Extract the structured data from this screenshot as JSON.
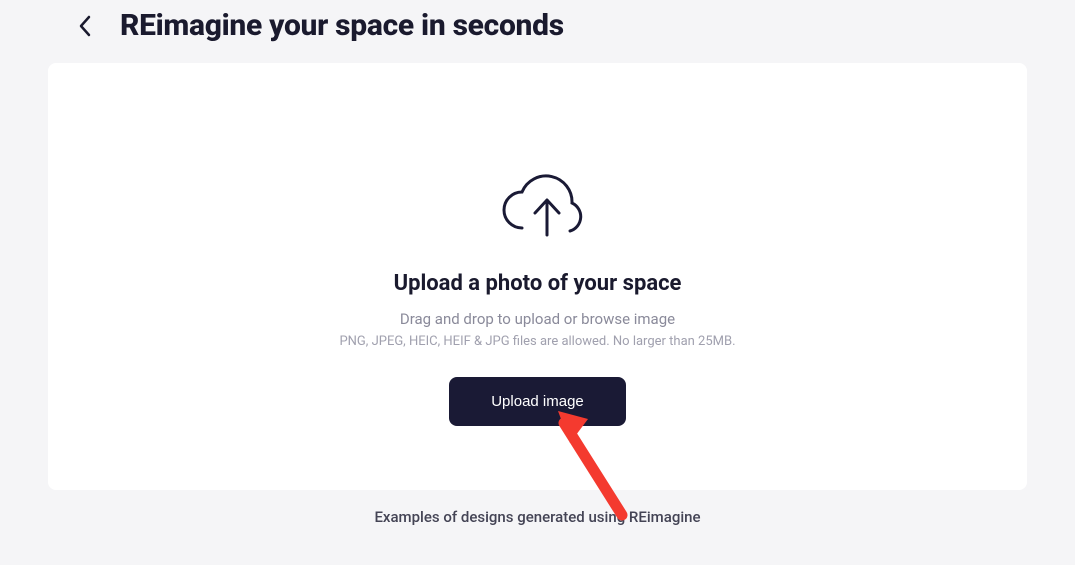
{
  "header": {
    "title": "REimagine your space in seconds"
  },
  "upload": {
    "heading": "Upload a photo of your space",
    "instruction": "Drag and drop to upload or browse image",
    "hint": "PNG, JPEG, HEIC, HEIF & JPG files are allowed. No larger than 25MB.",
    "button_label": "Upload image"
  },
  "footer": {
    "examples_caption": "Examples of designs generated using REimagine"
  },
  "colors": {
    "background": "#f5f5f7",
    "card": "#ffffff",
    "text_primary": "#1a1a2e",
    "text_secondary": "#8a8a9a",
    "text_hint": "#a0a0ae",
    "button_bg": "#1a1a35",
    "button_text": "#ffffff",
    "annotation_arrow": "#f43a2f"
  },
  "icons": {
    "back": "chevron-left-icon",
    "cloud_upload": "cloud-upload-icon"
  }
}
